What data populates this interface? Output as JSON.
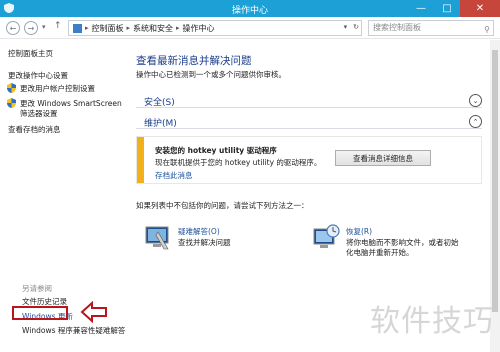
{
  "window": {
    "title": "操作中心",
    "minimize": "—",
    "maximize": "□",
    "close": "✕"
  },
  "nav": {
    "breadcrumbs": [
      "控制面板",
      "系统和安全",
      "操作中心"
    ],
    "search_placeholder": "搜索控制面板"
  },
  "sidebar": {
    "home": "控制面板主页",
    "items": [
      "更改操作中心设置",
      "更改用户帐户控制设置",
      "更改 Windows SmartScreen",
      "筛选器设置",
      "查看存档的消息"
    ],
    "see_also_label": "另请参阅",
    "see_also": [
      "文件历史记录",
      "Windows 更新",
      "Windows 程序兼容性疑难解答"
    ]
  },
  "main": {
    "heading": "查看最新消息并解决问题",
    "subheading": "操作中心已检测到一个或多个问题供你审核。",
    "sections": {
      "security": "安全(S)",
      "maintenance": "维护(M)"
    },
    "alert": {
      "title": "安装您的 hotkey utility 驱动程序",
      "body": "现在联机提供于您的 hotkey utility 的驱动程序。",
      "archive_link": "存档此消息",
      "button": "查看消息详细信息"
    },
    "hint": "如果列表中不包括你的问题，请尝试下列方法之一：",
    "troubleshoot": {
      "name": "疑难解答(O)",
      "desc": "查找并解决问题"
    },
    "recovery": {
      "name": "恢复(R)",
      "desc1": "将你电脑而不影响文件，或者初始",
      "desc2": "化电脑并重新开始。"
    }
  },
  "watermark": "软件技巧",
  "colors": {
    "titlebar": "#1ca0d6",
    "link": "#1b4f9c",
    "heading": "#1b3d8f",
    "alert_bar": "#f2b01b",
    "highlight": "#b8151d"
  }
}
